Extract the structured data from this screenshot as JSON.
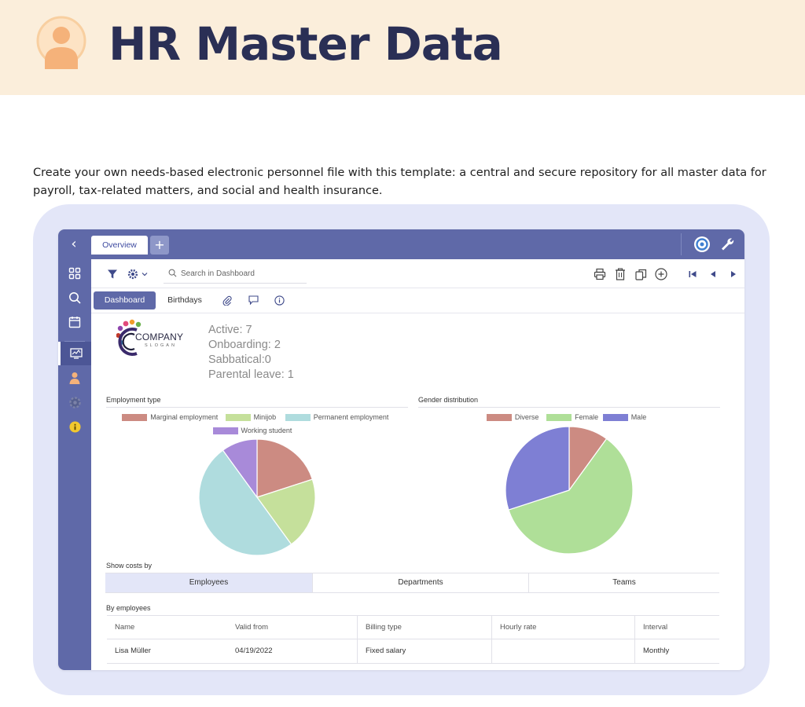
{
  "hero": {
    "title": "HR Master Data"
  },
  "intro": "Create your own needs-based electronic personnel file with this template: a central and secure repository for all master data for payroll, tax-related matters, and social and health insurance.",
  "app": {
    "tabs_top": [
      {
        "label": "Overview"
      }
    ],
    "add_tab_label": "+",
    "search": {
      "placeholder": "Search in Dashboard",
      "value": ""
    },
    "view_tabs": [
      {
        "label": "Dashboard"
      },
      {
        "label": "Birthdays"
      }
    ],
    "toolbar_icons": [
      "filter-icon",
      "gear-icon",
      "print-icon",
      "trash-icon",
      "copy-icon",
      "add-circle-icon",
      "first-record-icon",
      "prev-record-icon",
      "next-record-icon",
      "last-record-icon"
    ],
    "tab_icons": [
      "paperclip-icon",
      "comment-icon",
      "info-icon"
    ],
    "sidebar_icons": [
      "grid-icon",
      "search-icon",
      "calendar-icon",
      "dashboard-icon",
      "person-icon",
      "gear-icon",
      "info-icon"
    ],
    "logo": {
      "line1": "COMPANY",
      "line2": "SLOGAN"
    },
    "status": [
      "Active: 7",
      "Onboarding: 2",
      "Sabbatical:0",
      "Parental leave: 1"
    ],
    "show_costs": {
      "title": "Show costs by",
      "options": [
        "Employees",
        "Departments",
        "Teams"
      ],
      "selected": "Employees"
    },
    "by_employees": {
      "title": "By employees",
      "columns": [
        "Name",
        "Valid from",
        "Billing type",
        "Hourly rate",
        "Interval"
      ],
      "rows": [
        [
          "Lisa Müller",
          "04/19/2022",
          "Fixed salary",
          "",
          "Monthly"
        ]
      ]
    }
  },
  "colors": {
    "brand": "#5f69a8",
    "hero_bg": "#fbeedb",
    "frame_bg": "#e3e6f8"
  },
  "chart_data": [
    {
      "type": "pie",
      "title": "Employment type",
      "categories": [
        "Marginal employment",
        "Minijob",
        "Permanent employment",
        "Working student"
      ],
      "values": [
        2,
        2,
        5,
        1
      ],
      "colors": [
        "#cc8b82",
        "#c5e09b",
        "#afdcde",
        "#a88ad9"
      ],
      "legend": "top"
    },
    {
      "type": "pie",
      "title": "Gender distribution",
      "categories": [
        "Diverse",
        "Female",
        "Male"
      ],
      "values": [
        1,
        6,
        3
      ],
      "colors": [
        "#cc8b82",
        "#afdf98",
        "#7e7fd4"
      ],
      "legend": "top"
    }
  ]
}
